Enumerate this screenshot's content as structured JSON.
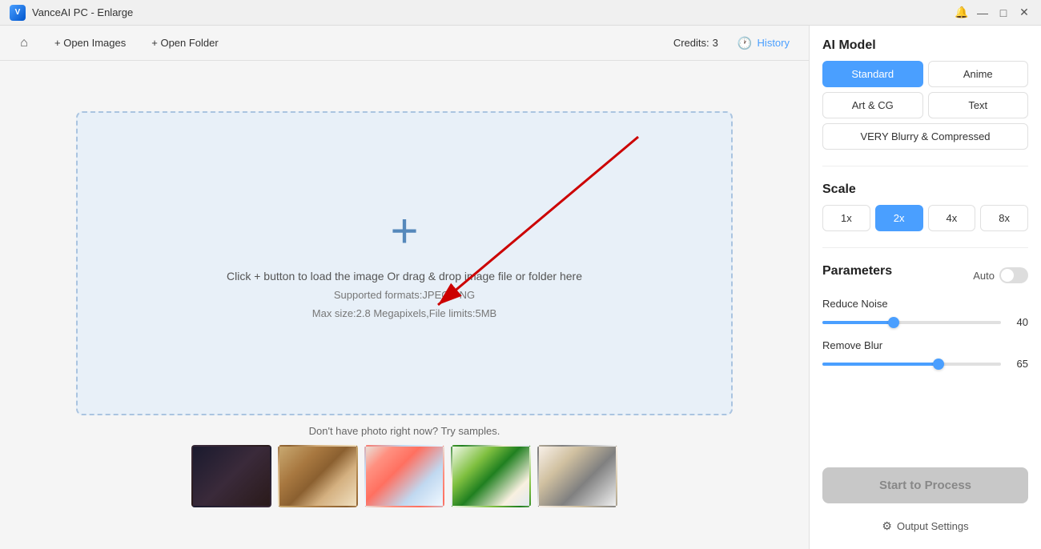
{
  "titleBar": {
    "title": "VanceAI PC - Enlarge",
    "appIconText": "V",
    "controls": {
      "minimize": "—",
      "maximize": "□",
      "close": "✕"
    }
  },
  "toolbar": {
    "homeLabel": "⌂",
    "openImagesLabel": "+ Open Images",
    "openFolderLabel": "+ Open Folder",
    "creditsLabel": "Credits:",
    "creditsValue": "3",
    "historyLabel": "History"
  },
  "dropZone": {
    "line1": "Click + button to load the image Or drag & drop image file or folder here",
    "line2": "Supported formats:JPEG,PNG",
    "line3": "Max size:2.8 Megapixels,File limits:5MB"
  },
  "samples": {
    "prompt": "Don't have photo right now? Try samples."
  },
  "rightPanel": {
    "aiModelTitle": "AI Model",
    "models": [
      {
        "id": "standard",
        "label": "Standard",
        "active": true
      },
      {
        "id": "anime",
        "label": "Anime",
        "active": false
      },
      {
        "id": "artcg",
        "label": "Art & CG",
        "active": false
      },
      {
        "id": "text",
        "label": "Text",
        "active": false
      },
      {
        "id": "veryblurry",
        "label": "VERY Blurry & Compressed",
        "active": false,
        "wide": true
      }
    ],
    "scaleTitle": "Scale",
    "scales": [
      {
        "value": "1x",
        "active": false
      },
      {
        "value": "2x",
        "active": true
      },
      {
        "value": "4x",
        "active": false
      },
      {
        "value": "8x",
        "active": false
      }
    ],
    "parametersTitle": "Parameters",
    "autoLabel": "Auto",
    "reduceNoiseLabel": "Reduce Noise",
    "reduceNoiseValue": "40",
    "reduceNoisePercent": 40,
    "removeBlurLabel": "Remove Blur",
    "removeBlurValue": "65",
    "removeBlurPercent": 65,
    "startButtonLabel": "Start to Process",
    "outputSettingsLabel": "Output Settings",
    "gearIcon": "⚙"
  }
}
